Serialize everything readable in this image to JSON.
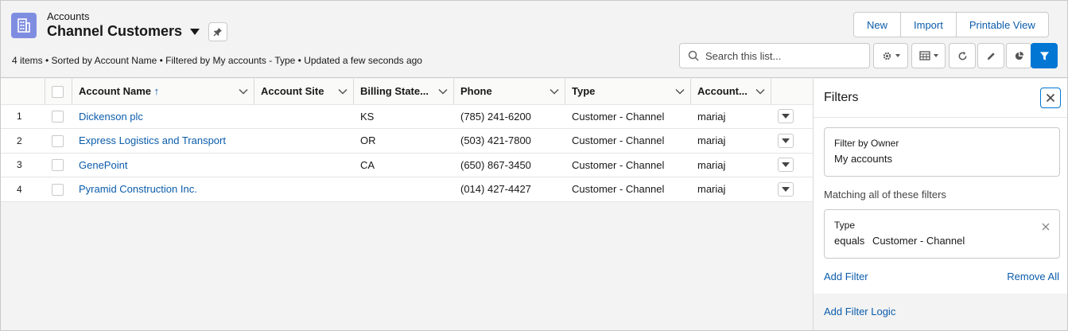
{
  "header": {
    "object_label": "Accounts",
    "list_title": "Channel Customers",
    "meta": "4 items • Sorted by Account Name • Filtered by My accounts - Type • Updated a few seconds ago",
    "buttons": [
      "New",
      "Import",
      "Printable View"
    ],
    "search_placeholder": "Search this list...",
    "icons": [
      "gear-icon",
      "table-view-icon",
      "refresh-icon",
      "pencil-icon",
      "pie-chart-icon",
      "filter-icon"
    ]
  },
  "table": {
    "columns": [
      "Account Name",
      "Account Site",
      "Billing State...",
      "Phone",
      "Type",
      "Account..."
    ],
    "sort_indicator": "↑",
    "rows": [
      {
        "num": "1",
        "name": "Dickenson plc",
        "site": "",
        "state": "KS",
        "phone": "(785) 241-6200",
        "type": "Customer - Channel",
        "owner": "mariaj"
      },
      {
        "num": "2",
        "name": "Express Logistics and Transport",
        "site": "",
        "state": "OR",
        "phone": "(503) 421-7800",
        "type": "Customer - Channel",
        "owner": "mariaj"
      },
      {
        "num": "3",
        "name": "GenePoint",
        "site": "",
        "state": "CA",
        "phone": "(650) 867-3450",
        "type": "Customer - Channel",
        "owner": "mariaj"
      },
      {
        "num": "4",
        "name": "Pyramid Construction Inc.",
        "site": "",
        "state": "",
        "phone": "(014) 427-4427",
        "type": "Customer - Channel",
        "owner": "mariaj"
      }
    ]
  },
  "filters": {
    "title": "Filters",
    "owner_filter": {
      "label": "Filter by Owner",
      "value": "My accounts"
    },
    "matching_label": "Matching all of these filters",
    "type_filter": {
      "label": "Type",
      "operator": "equals",
      "value": "Customer - Channel"
    },
    "add_filter": "Add Filter",
    "remove_all": "Remove All",
    "add_filter_logic": "Add Filter Logic"
  },
  "colors": {
    "accent": "#0176d3",
    "link": "#0b5cab",
    "object_icon": "#7f8de1"
  }
}
